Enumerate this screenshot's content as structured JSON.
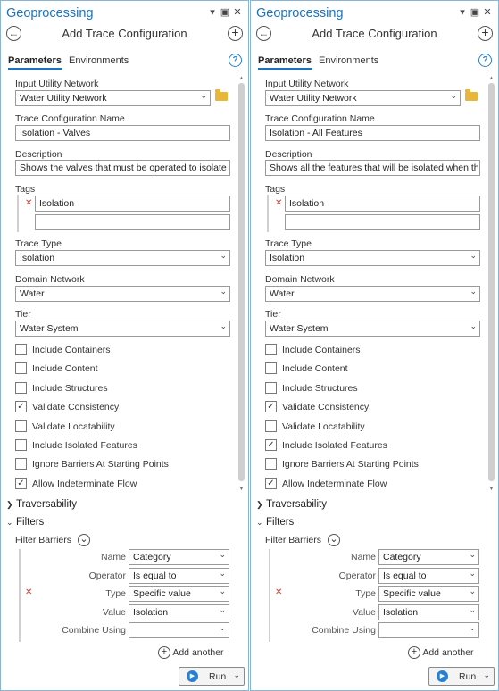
{
  "panes": [
    {
      "title": "Geoprocessing",
      "tool_title": "Add Trace Configuration",
      "tabs": [
        "Parameters",
        "Environments"
      ],
      "input_network_label": "Input Utility Network",
      "input_network_value": "Water Utility Network",
      "trace_name_label": "Trace Configuration Name",
      "trace_name_value": "Isolation - Valves",
      "description_label": "Description",
      "description_value": "Shows the valves that must be operated to isolate an",
      "tags_label": "Tags",
      "tag_value": "Isolation",
      "trace_type_label": "Trace Type",
      "trace_type_value": "Isolation",
      "domain_label": "Domain Network",
      "domain_value": "Water",
      "tier_label": "Tier",
      "tier_value": "Water System",
      "checkboxes": [
        {
          "label": "Include Containers",
          "checked": false,
          "mark": ""
        },
        {
          "label": "Include Content",
          "checked": false,
          "mark": ""
        },
        {
          "label": "Include Structures",
          "checked": false,
          "mark": ""
        },
        {
          "label": "Validate Consistency",
          "checked": true,
          "mark": "✓"
        },
        {
          "label": "Validate Locatability",
          "checked": false,
          "mark": ""
        },
        {
          "label": "Include Isolated Features",
          "checked": false,
          "mark": ""
        },
        {
          "label": "Ignore Barriers At Starting Points",
          "checked": false,
          "mark": ""
        },
        {
          "label": "Allow Indeterminate Flow",
          "checked": true,
          "mark": "✓"
        }
      ],
      "section_traversability": "Traversability",
      "section_filters": "Filters",
      "filter_barriers_label": "Filter Barriers",
      "filter_rows": [
        {
          "label": "Name",
          "value": "Category"
        },
        {
          "label": "Operator",
          "value": "Is equal to"
        },
        {
          "label": "Type",
          "value": "Specific value"
        },
        {
          "label": "Value",
          "value": "Isolation"
        },
        {
          "label": "Combine Using",
          "value": ""
        }
      ],
      "add_another": "Add another",
      "run": "Run"
    },
    {
      "title": "Geoprocessing",
      "tool_title": "Add Trace Configuration",
      "tabs": [
        "Parameters",
        "Environments"
      ],
      "input_network_label": "Input Utility Network",
      "input_network_value": "Water Utility Network",
      "trace_name_label": "Trace Configuration Name",
      "trace_name_value": "Isolation - All Features",
      "description_label": "Description",
      "description_value": "Shows all the features that will be isolated when this",
      "tags_label": "Tags",
      "tag_value": "Isolation",
      "trace_type_label": "Trace Type",
      "trace_type_value": "Isolation",
      "domain_label": "Domain Network",
      "domain_value": "Water",
      "tier_label": "Tier",
      "tier_value": "Water System",
      "checkboxes": [
        {
          "label": "Include Containers",
          "checked": false,
          "mark": ""
        },
        {
          "label": "Include Content",
          "checked": false,
          "mark": ""
        },
        {
          "label": "Include Structures",
          "checked": false,
          "mark": ""
        },
        {
          "label": "Validate Consistency",
          "checked": true,
          "mark": "✓"
        },
        {
          "label": "Validate Locatability",
          "checked": false,
          "mark": ""
        },
        {
          "label": "Include Isolated Features",
          "checked": true,
          "mark": "✓"
        },
        {
          "label": "Ignore Barriers At Starting Points",
          "checked": false,
          "mark": ""
        },
        {
          "label": "Allow Indeterminate Flow",
          "checked": true,
          "mark": "✓"
        }
      ],
      "section_traversability": "Traversability",
      "section_filters": "Filters",
      "filter_barriers_label": "Filter Barriers",
      "filter_rows": [
        {
          "label": "Name",
          "value": "Category"
        },
        {
          "label": "Operator",
          "value": "Is equal to"
        },
        {
          "label": "Type",
          "value": "Specific value"
        },
        {
          "label": "Value",
          "value": "Isolation"
        },
        {
          "label": "Combine Using",
          "value": ""
        }
      ],
      "add_another": "Add another",
      "run": "Run"
    }
  ]
}
